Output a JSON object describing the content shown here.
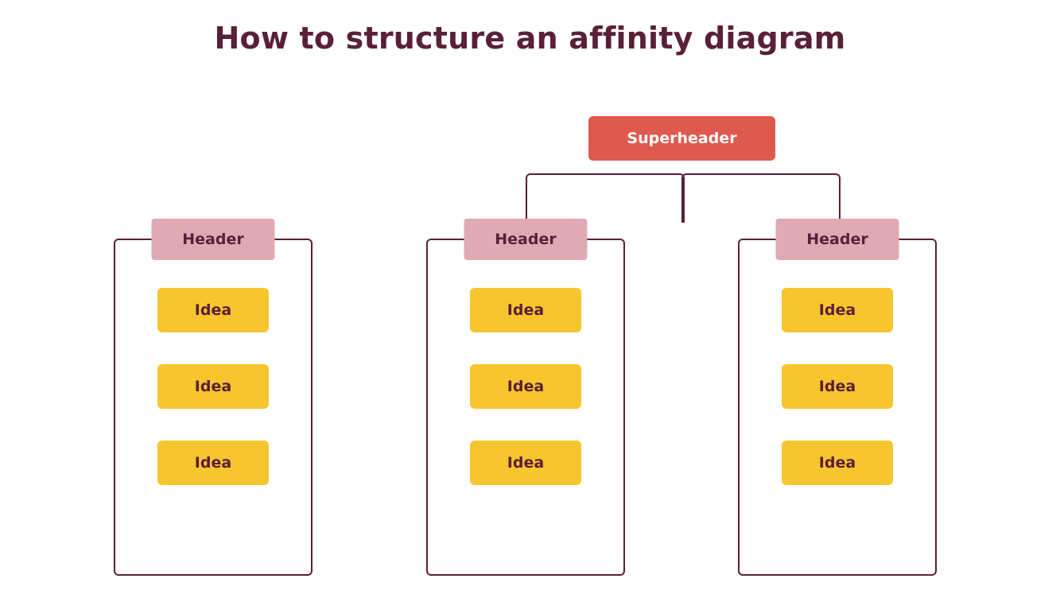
{
  "title": "How to structure an affinity diagram",
  "superheader": "Superheader",
  "columns": [
    {
      "header": "Header",
      "ideas": [
        "Idea",
        "Idea",
        "Idea"
      ]
    },
    {
      "header": "Header",
      "ideas": [
        "Idea",
        "Idea",
        "Idea"
      ]
    },
    {
      "header": "Header",
      "ideas": [
        "Idea",
        "Idea",
        "Idea"
      ]
    }
  ],
  "colors": {
    "plum": "#5a2038",
    "pink": "#e0aab5",
    "coral": "#e0594f",
    "gold": "#f7c52d"
  }
}
